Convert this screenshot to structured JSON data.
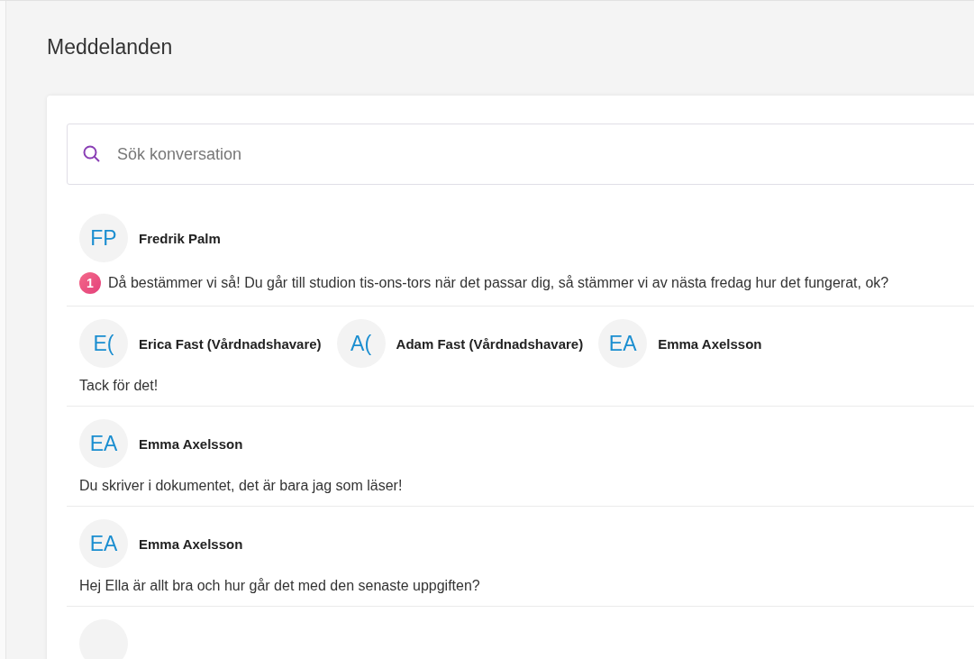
{
  "page": {
    "title": "Meddelanden"
  },
  "search": {
    "placeholder": "Sök konversation"
  },
  "conversations": [
    {
      "participants": [
        {
          "initials": "FP",
          "name": "Fredrik Palm"
        }
      ],
      "unread": "1",
      "message": "Då bestämmer vi så! Du går till studion tis-ons-tors när det passar dig, så stämmer vi av nästa fredag hur det fungerat, ok?"
    },
    {
      "participants": [
        {
          "initials": "E(",
          "name": "Erica Fast (Vårdnadshavare)"
        },
        {
          "initials": "A(",
          "name": "Adam Fast (Vårdnadshavare)"
        },
        {
          "initials": "EA",
          "name": "Emma Axelsson"
        }
      ],
      "message": "Tack för det!"
    },
    {
      "participants": [
        {
          "initials": "EA",
          "name": "Emma Axelsson"
        }
      ],
      "message": "Du skriver i dokumentet, det är bara jag som läser!"
    },
    {
      "participants": [
        {
          "initials": "EA",
          "name": "Emma Axelsson"
        }
      ],
      "message": "Hej Ella är allt bra och hur går det med den senaste uppgiften?"
    }
  ]
}
